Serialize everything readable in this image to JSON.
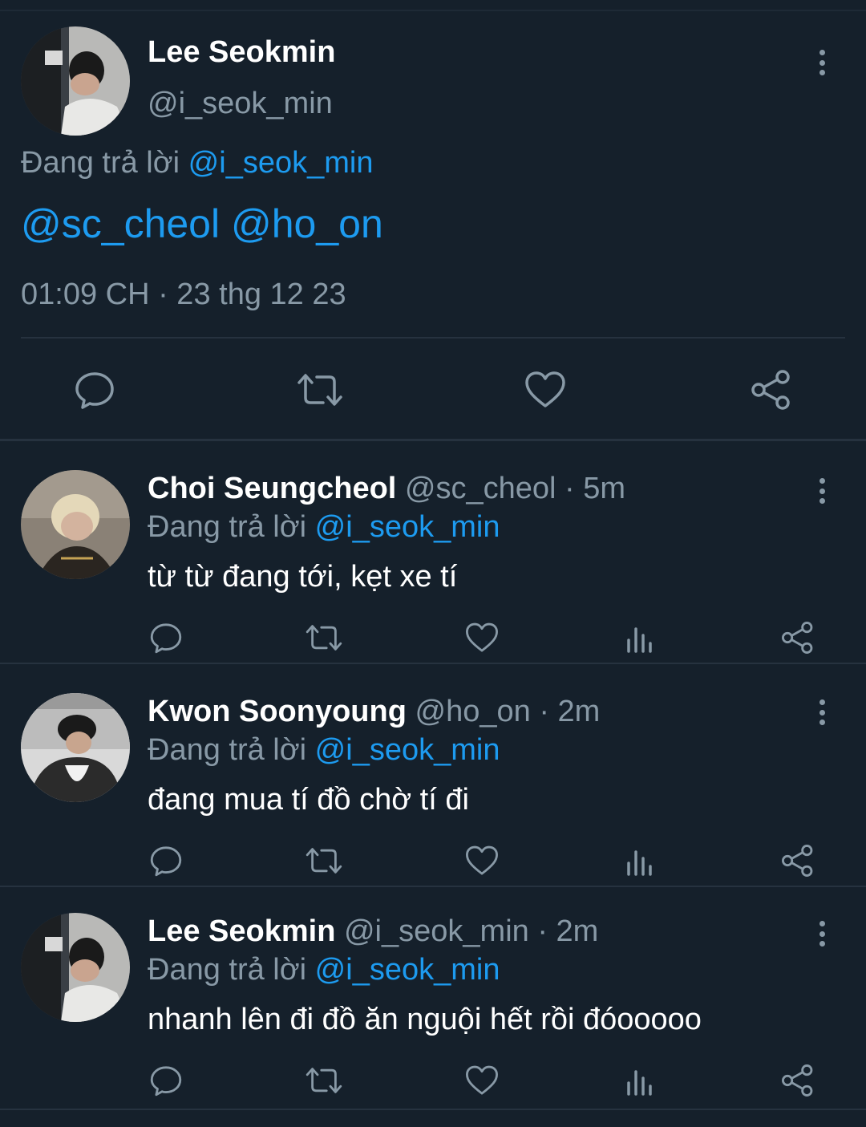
{
  "main_tweet": {
    "author_name": "Lee Seokmin",
    "author_handle": "@i_seok_min",
    "replying_prefix": "Đang trả lời",
    "replying_to": "@i_seok_min",
    "body": "@sc_cheol @ho_on",
    "timestamp": "01:09 CH · 23 thg 12 23",
    "actions": [
      "reply-icon",
      "retweet-icon",
      "like-icon",
      "share-icon"
    ]
  },
  "replies": [
    {
      "author_name": "Choi Seungcheol",
      "handle_time": "@sc_cheol · 5m",
      "replying_prefix": "Đang trả lời",
      "replying_to": "@i_seok_min",
      "text": "từ từ đang tới, kẹt xe tí"
    },
    {
      "author_name": "Kwon Soonyoung",
      "handle_time": "@ho_on · 2m",
      "replying_prefix": "Đang trả lời",
      "replying_to": "@i_seok_min",
      "text": "đang mua tí đồ chờ tí đi"
    },
    {
      "author_name": "Lee Seokmin",
      "handle_time": "@i_seok_min · 2m",
      "replying_prefix": "Đang trả lời",
      "replying_to": "@i_seok_min",
      "text": "nhanh lên đi đồ ăn nguội hết rồi đóooooo"
    }
  ],
  "colors": {
    "background": "#15202b",
    "link": "#1d9bf0",
    "muted": "#8899a6",
    "divider": "#26323f"
  }
}
